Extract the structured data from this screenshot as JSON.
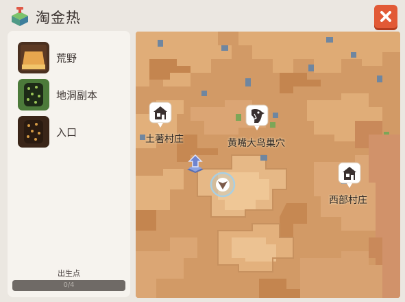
{
  "header": {
    "title": "淘金热",
    "icon": "grass-cube-icon",
    "close_icon": "close-x-icon"
  },
  "sidebar": {
    "items": [
      {
        "label": "荒野",
        "icon": "wilderness-thumb"
      },
      {
        "label": "地洞副本",
        "icon": "cave-dungeon-thumb"
      },
      {
        "label": "入口",
        "icon": "entrance-thumb"
      }
    ],
    "spawn": {
      "label": "出生点",
      "progress_text": "0/4",
      "progress": 0
    }
  },
  "map": {
    "markers": [
      {
        "label": "土著村庄",
        "icon": "house-icon"
      },
      {
        "label": "黄嘴大鸟巢穴",
        "icon": "bird-head-icon"
      },
      {
        "label": "西部村庄",
        "icon": "house-icon"
      }
    ],
    "player_icon": "player-arrow-icon",
    "teleport_icon": "teleport-arrow-icon"
  },
  "colors": {
    "accent": "#e25a36",
    "terrain_light": "#d9a06a",
    "terrain_dark": "#c48655",
    "water": "#6f86a0"
  }
}
